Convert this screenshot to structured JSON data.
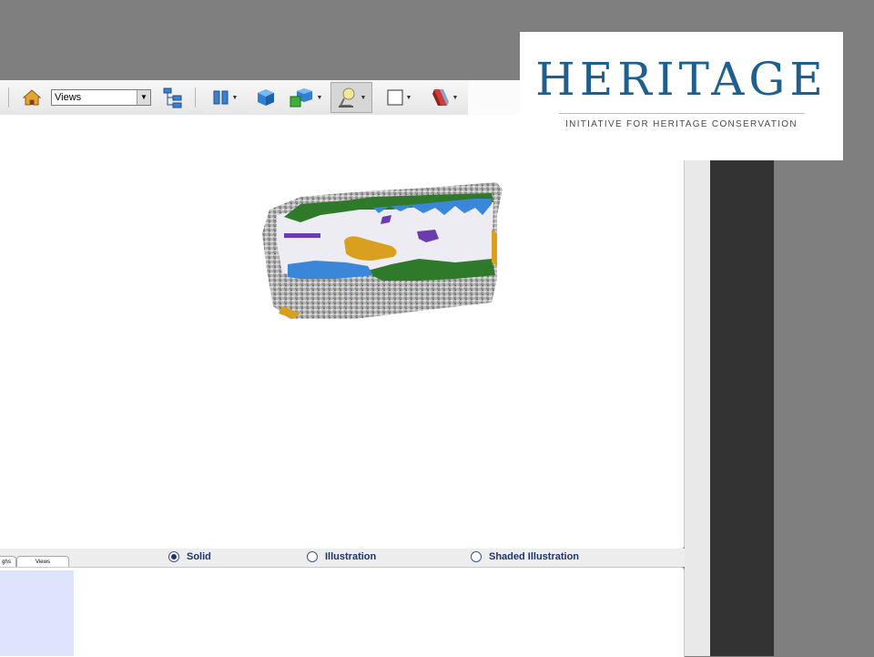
{
  "toolbar": {
    "view_select": "Views"
  },
  "render_modes": {
    "tabs": [
      "ghs",
      "Views"
    ],
    "options": [
      {
        "label": "Solid",
        "selected": true
      },
      {
        "label": "Illustration",
        "selected": false
      },
      {
        "label": "Shaded Illustration",
        "selected": false
      }
    ]
  },
  "logo": {
    "title": "HERITAGE",
    "subtitle": "INITIATIVE FOR HERITAGE CONSERVATION"
  },
  "icons": [
    "home-icon",
    "model-tree-icon",
    "split-view-icon",
    "cube-icon",
    "multi-cube-icon",
    "lighting-icon",
    "background-color-icon",
    "render-style-icon"
  ],
  "colors": {
    "logo_blue": "#1f5f8e",
    "model_green": "#2e7a2a",
    "model_blue": "#3a86d8",
    "model_purple": "#6a3cb0",
    "model_ochre": "#d9a020",
    "model_stone": "#b0b0b0"
  }
}
